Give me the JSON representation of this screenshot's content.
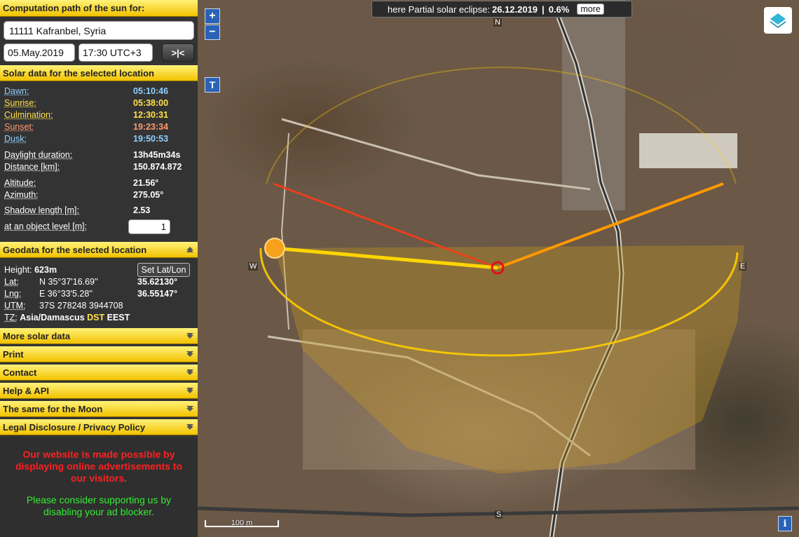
{
  "sidebar": {
    "header": "Computation path of the sun for:",
    "location_value": "11111 Kafranbel, Syria",
    "date_value": "05.May.2019",
    "time_value": "17:30 UTC+3",
    "go_button": ">|<",
    "solar_header": "Solar data for the selected location",
    "solar": {
      "dawn": {
        "label": "Dawn:",
        "value": "05:10:46",
        "color": "#8fd0ff"
      },
      "sunrise": {
        "label": "Sunrise:",
        "value": "05:38:00",
        "color": "#ffe14a"
      },
      "culmination": {
        "label": "Culmination:",
        "value": "12:30:31",
        "color": "#ffe14a"
      },
      "sunset": {
        "label": "Sunset:",
        "value": "19:23:34",
        "color": "#ff9a6b"
      },
      "dusk": {
        "label": "Dusk:",
        "value": "19:50:53",
        "color": "#8fd0ff"
      },
      "daylight": {
        "label": "Daylight duration:",
        "value": "13h45m34s"
      },
      "distance": {
        "label": "Distance [km]:",
        "value": "150.874.872"
      },
      "altitude": {
        "label": "Altitude:",
        "value": "21.56°"
      },
      "azimuth": {
        "label": "Azimuth:",
        "value": "275.05°"
      },
      "shadow": {
        "label": "Shadow length [m]:",
        "value": "2.53"
      },
      "object_level": {
        "label": "at an object level [m]:",
        "value": "1"
      }
    },
    "geo_header": "Geodata for the selected location",
    "geo": {
      "height_label": "Height:",
      "height_value": "623m",
      "set_latlon": "Set Lat/Lon",
      "lat_label": "Lat:",
      "lat_dms": "N 35°37'16.69''",
      "lat_dec": "35.62130°",
      "lng_label": "Lng:",
      "lng_dms": "E 36°33'5.28''",
      "lng_dec": "36.55147°",
      "utm_label": "UTM:",
      "utm_value": "37S 278248 3944708",
      "tz_label": "TZ:",
      "tz_zone": "Asia/Damascus",
      "tz_dst": "DST",
      "tz_abbr": "EEST"
    },
    "menus": [
      "More solar data",
      "Print",
      "Contact",
      "Help & API",
      "The same for the Moon",
      "Legal Disclosure / Privacy Policy"
    ],
    "ad_text_red": "Our website is made possible by displaying online advertisements to our visitors.",
    "ad_text_green": "Please consider supporting us by disabling your ad blocker."
  },
  "map": {
    "zoom_in": "+",
    "zoom_out": "−",
    "t_button": "T",
    "eclipse_prefix": "here Partial solar eclipse:",
    "eclipse_date": "26.12.2019",
    "eclipse_sep": "|",
    "eclipse_pct": "0.6%",
    "more_button": "more",
    "info_button": "i",
    "scale_label": "100 m",
    "compass": {
      "n": "N",
      "s": "S",
      "e": "E",
      "w": "W"
    }
  }
}
